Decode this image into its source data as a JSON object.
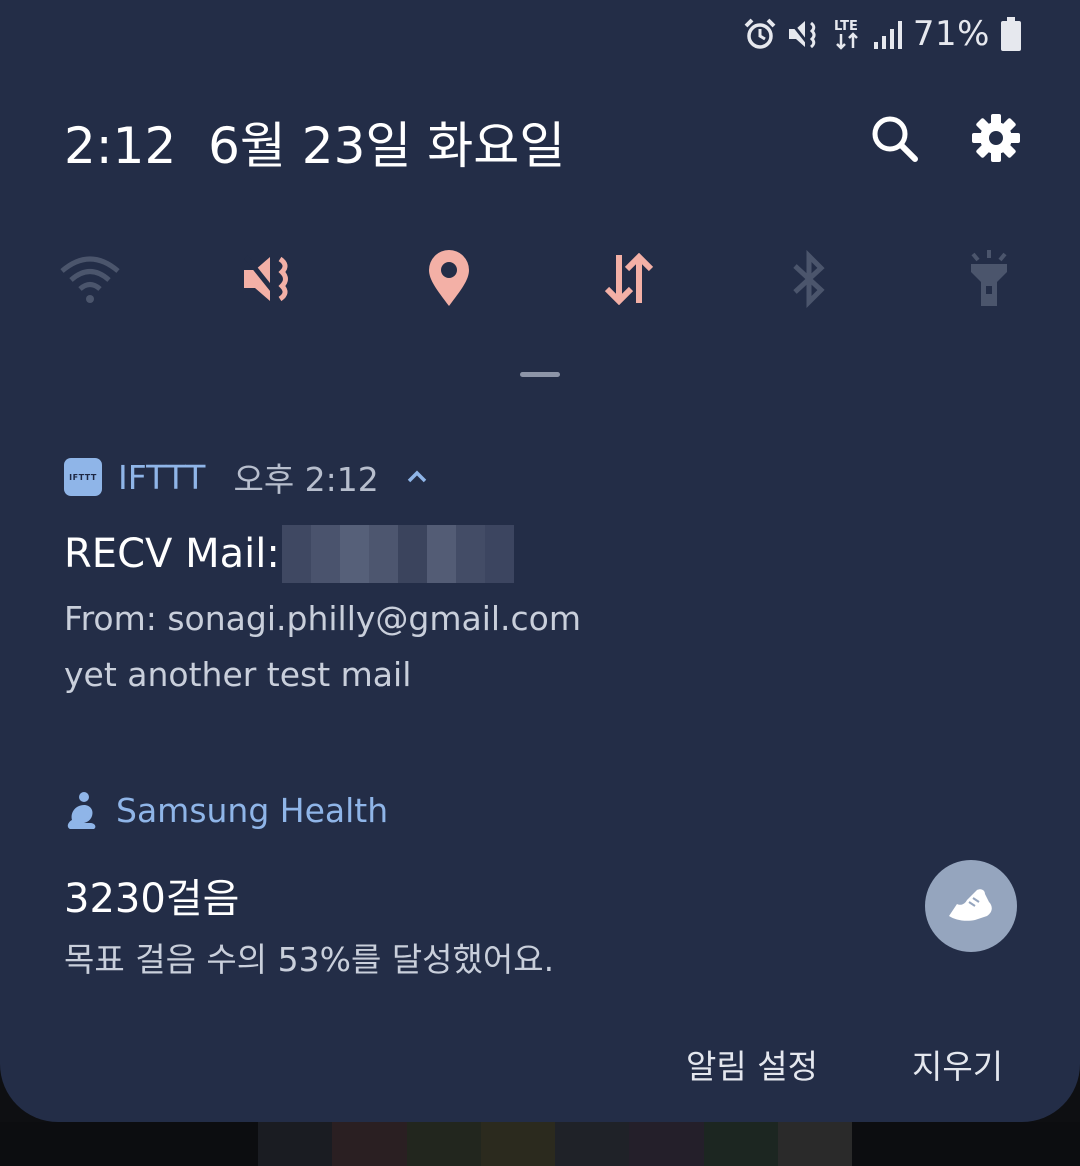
{
  "status_bar": {
    "battery_percent": "71%",
    "network": "LTE",
    "icons": [
      "alarm-icon",
      "vibrate-icon",
      "lte-icon",
      "signal-icon",
      "battery-icon"
    ]
  },
  "header": {
    "time": "2:12",
    "date": "6월 23일 화요일",
    "icons": [
      "search-icon",
      "gear-icon"
    ]
  },
  "quick_settings": [
    {
      "name": "wifi",
      "icon": "wifi-icon",
      "active": false
    },
    {
      "name": "sound",
      "icon": "vibrate-icon",
      "active": true
    },
    {
      "name": "location",
      "icon": "location-icon",
      "active": true
    },
    {
      "name": "mobile-data",
      "icon": "data-transfer-icon",
      "active": true
    },
    {
      "name": "bluetooth",
      "icon": "bluetooth-icon",
      "active": false
    },
    {
      "name": "flashlight",
      "icon": "flashlight-icon",
      "active": false
    }
  ],
  "colors": {
    "background": "#232d47",
    "active_tile": "#f3b0a6",
    "inactive_tile": "#4b556c",
    "app_name": "#8fb5e8"
  },
  "notifications": [
    {
      "app": "IFTTT",
      "app_icon_text": "IFTTT",
      "time": "오후 2:12",
      "title": "RECV Mail:",
      "lines": [
        "From: sonagi.philly@gmail.com",
        "yet another test mail"
      ]
    },
    {
      "app": "Samsung Health",
      "title": "3230걸음",
      "lines": [
        "목표 걸음 수의 53%를 달성했어요."
      ],
      "action_icon": "shoe-icon"
    }
  ],
  "footer": {
    "settings_label": "알림 설정",
    "clear_label": "지우기"
  }
}
